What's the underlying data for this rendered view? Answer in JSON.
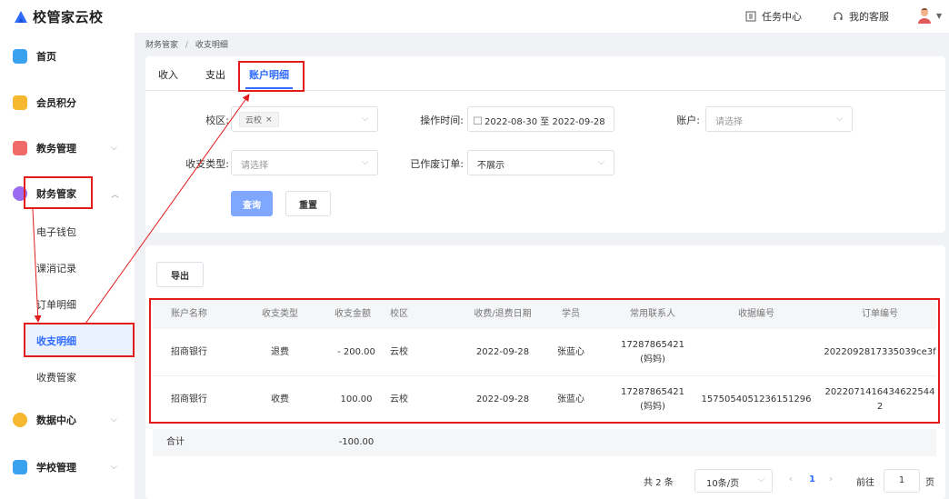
{
  "app": {
    "title": "校管家云校"
  },
  "header": {
    "task_center": "任务中心",
    "support": "我的客服",
    "colors": {
      "brand": "#2f6bff"
    }
  },
  "sidebar": {
    "items": [
      {
        "label": "首页",
        "icon": "home-icon"
      },
      {
        "label": "会员积分",
        "icon": "crown-icon"
      },
      {
        "label": "教务管理",
        "icon": "calendar-icon"
      },
      {
        "label": "财务管家",
        "icon": "finance-icon"
      },
      {
        "label": "数据中心",
        "icon": "chart-icon"
      },
      {
        "label": "学校管理",
        "icon": "school-icon"
      }
    ],
    "finance_sub": [
      "电子钱包",
      "课消记录",
      "订单明细",
      "收支明细",
      "收费管家"
    ]
  },
  "breadcrumb": {
    "parent": "财务管家",
    "sep": "/",
    "current": "收支明细"
  },
  "tabs": [
    "收入",
    "支出",
    "账户明细"
  ],
  "filters": {
    "campus_label": "校区:",
    "campus_tag": "云校",
    "time_label": "操作时间:",
    "time_value": "2022-08-30 至 2022-09-28",
    "account_label": "账户:",
    "account_placeholder": "请选择",
    "type_label": "收支类型:",
    "type_placeholder": "请选择",
    "voided_label": "已作废订单:",
    "voided_value": "不展示",
    "query": "查询",
    "reset": "重置"
  },
  "table": {
    "export": "导出",
    "headers": [
      "账户名称",
      "收支类型",
      "收支金额",
      "校区",
      "收费/退费日期",
      "学员",
      "常用联系人",
      "收据编号",
      "订单编号"
    ],
    "rows": [
      {
        "account": "招商银行",
        "type": "退费",
        "amount": "- 200.00",
        "campus": "云校",
        "date": "2022-09-28",
        "student": "张蓝心",
        "contact_phone": "17287865421",
        "contact_rel": "(妈妈)",
        "receipt": "",
        "order_l1": "2022092817335039ce3f",
        "order_l2": ""
      },
      {
        "account": "招商银行",
        "type": "收费",
        "amount": "100.00",
        "campus": "云校",
        "date": "2022-09-28",
        "student": "张蓝心",
        "contact_phone": "17287865421",
        "contact_rel": "(妈妈)",
        "receipt": "1575054051236151296",
        "order_l1": "2022071416434622544",
        "order_l2": "2"
      }
    ],
    "total_label": "合计",
    "total_amount": "-100.00"
  },
  "pagination": {
    "total": "共 2 条",
    "page_size": "10条/页",
    "current_page": "1",
    "goto_label": "前往",
    "goto_value": "1",
    "page_unit": "页"
  }
}
